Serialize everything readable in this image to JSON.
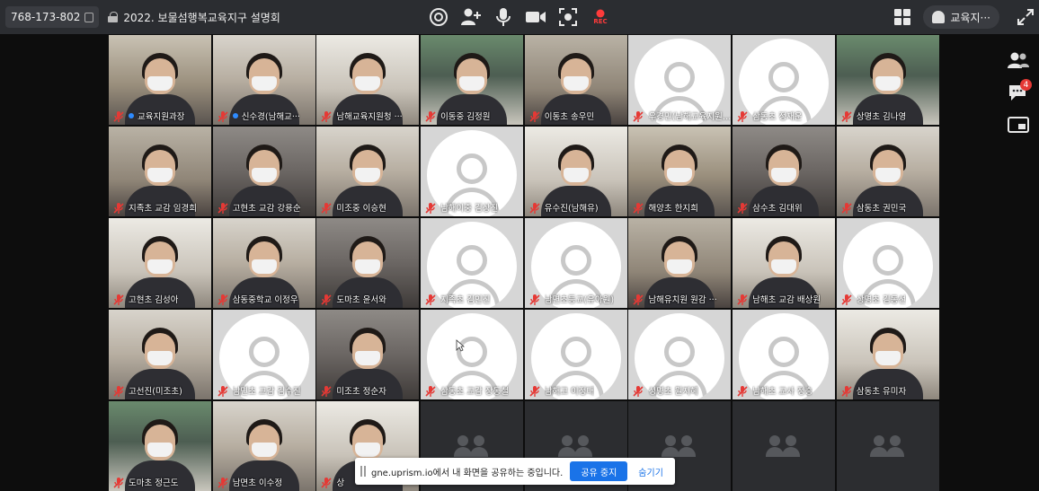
{
  "topbar": {
    "meeting_id": "768-173-802",
    "meeting_title": "2022. 보물섬행복교육지구 설명회",
    "rec_label": "REC",
    "user_name": "교육지···"
  },
  "sidebar": {
    "chat_badge": "4"
  },
  "tiles": [
    {
      "name": "교육지원과장",
      "kind": "video",
      "style": "vid-1",
      "mic": "off",
      "dot": true
    },
    {
      "name": "신수경(남해교···",
      "kind": "video",
      "style": "vid-2",
      "mic": "off",
      "dot": true
    },
    {
      "name": "남해교육지원청 ···",
      "kind": "video",
      "style": "vid-4",
      "mic": "off",
      "dot": false
    },
    {
      "name": "이동중 김정원",
      "kind": "video",
      "style": "vid-3",
      "mic": "off",
      "dot": false
    },
    {
      "name": "이동초 송우민",
      "kind": "video",
      "style": "vid-6",
      "mic": "off",
      "dot": false
    },
    {
      "name": "우경민(남해교육지원청)",
      "kind": "placeholder",
      "mic": "off",
      "dot": false
    },
    {
      "name": "삼동초 정재운",
      "kind": "placeholder",
      "mic": "off",
      "dot": false
    },
    {
      "name": "상명초 김나영",
      "kind": "video",
      "style": "vid-3",
      "mic": "off",
      "dot": false
    },
    {
      "name": "지족초 교감 임경희",
      "kind": "video",
      "style": "vid-6",
      "mic": "off",
      "dot": false
    },
    {
      "name": "고현초 교감 강용순",
      "kind": "video",
      "style": "vid-5",
      "mic": "off",
      "dot": false
    },
    {
      "name": "미조중 이승현",
      "kind": "video",
      "style": "vid-2",
      "mic": "off",
      "dot": false
    },
    {
      "name": "남해이중 김상진",
      "kind": "placeholder",
      "mic": "off",
      "dot": false
    },
    {
      "name": "유수진(남해유)",
      "kind": "video",
      "style": "vid-4",
      "mic": "off",
      "dot": false
    },
    {
      "name": "해양초 한지희",
      "kind": "video",
      "style": "vid-1",
      "mic": "off",
      "dot": false
    },
    {
      "name": "삼수초 김대위",
      "kind": "video",
      "style": "vid-5",
      "mic": "off",
      "dot": false
    },
    {
      "name": "삼동초 권민국",
      "kind": "video",
      "style": "vid-2",
      "mic": "off",
      "dot": false
    },
    {
      "name": "고현초 김성아",
      "kind": "video",
      "style": "vid-4",
      "mic": "off",
      "dot": false
    },
    {
      "name": "삼동중학교 이정우",
      "kind": "video",
      "style": "vid-2",
      "mic": "off",
      "dot": false
    },
    {
      "name": "도마초 윤서와",
      "kind": "video",
      "style": "vid-5",
      "mic": "off",
      "dot": false
    },
    {
      "name": "지족초 김인진",
      "kind": "placeholder",
      "mic": "off",
      "dot": false
    },
    {
      "name": "남면초등교(유아원)",
      "kind": "placeholder",
      "mic": "off",
      "dot": false
    },
    {
      "name": "남해유치원 원감 ···",
      "kind": "video",
      "style": "vid-6",
      "mic": "off",
      "dot": false
    },
    {
      "name": "남해초 교감 배상원",
      "kind": "video",
      "style": "vid-4",
      "mic": "off",
      "dot": false
    },
    {
      "name": "상명초 김동선",
      "kind": "placeholder",
      "mic": "off",
      "dot": false
    },
    {
      "name": "고선진(미조초)",
      "kind": "video",
      "style": "vid-2",
      "mic": "off",
      "dot": false
    },
    {
      "name": "남면초 교감 김수진",
      "kind": "placeholder",
      "mic": "off",
      "dot": false
    },
    {
      "name": "미조초 정순자",
      "kind": "video",
      "style": "vid-5",
      "mic": "off",
      "dot": false
    },
    {
      "name": "삼동초 교감 장동철",
      "kind": "placeholder",
      "mic": "off",
      "dot": false
    },
    {
      "name": "남해고 이정대",
      "kind": "placeholder",
      "mic": "off",
      "dot": false
    },
    {
      "name": "성명초 원지혜",
      "kind": "placeholder",
      "mic": "off",
      "dot": false
    },
    {
      "name": "남해초 교사 정승",
      "kind": "placeholder",
      "mic": "off",
      "dot": false
    },
    {
      "name": "삼동초 유미자",
      "kind": "video",
      "style": "vid-4",
      "mic": "off",
      "dot": false
    },
    {
      "name": "도마초 정근도",
      "kind": "video",
      "style": "vid-3",
      "mic": "off",
      "dot": false
    },
    {
      "name": "남면초 이수정",
      "kind": "video",
      "style": "vid-2",
      "mic": "off",
      "dot": false
    },
    {
      "name": "상",
      "kind": "video",
      "style": "vid-4",
      "mic": "off",
      "dot": false
    },
    {
      "name": "",
      "kind": "empty"
    },
    {
      "name": "",
      "kind": "empty"
    },
    {
      "name": "",
      "kind": "empty"
    },
    {
      "name": "",
      "kind": "empty"
    },
    {
      "name": "",
      "kind": "empty"
    }
  ],
  "share_bar": {
    "message": "gne.uprism.io에서 내 화면을 공유하는 중입니다.",
    "stop_label": "공유 중지",
    "hide_label": "숨기기"
  },
  "colors": {
    "topbar_bg": "#2b2d31",
    "accent_blue": "#1a73e8",
    "mic_off_red": "#e53935",
    "rec_red": "#ff3b3b"
  },
  "icons": {
    "topbar_center": [
      "camera-switch-icon",
      "add-user-icon",
      "microphone-icon",
      "video-camera-icon",
      "screenshot-icon",
      "record-icon"
    ],
    "topbar_right": [
      "grid-layout-icon",
      "user-icon",
      "fullscreen-icon"
    ],
    "sidebar": [
      "participants-icon",
      "chat-icon",
      "picture-in-picture-icon"
    ]
  }
}
